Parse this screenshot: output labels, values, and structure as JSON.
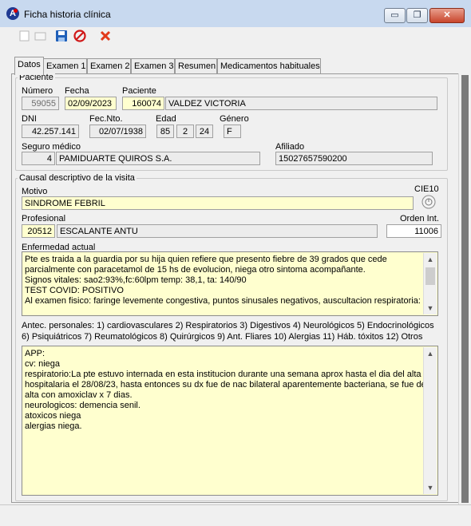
{
  "window": {
    "title": "Ficha historia clínica",
    "buttons": {
      "minimize": "▭",
      "maximize": "❐",
      "close": "✕"
    }
  },
  "toolbar": {
    "icons": [
      "new-doc-icon",
      "open-doc-icon",
      "save-icon",
      "cancel-icon",
      "delete-icon"
    ]
  },
  "tabs": [
    "Datos",
    "Examen 1",
    "Examen 2",
    "Examen 3",
    "Resumen",
    "Medicamentos habituales"
  ],
  "paciente": {
    "legend": "Paciente",
    "numero_label": "Número",
    "numero": "59055",
    "fecha_label": "Fecha",
    "fecha": "02/09/2023",
    "paciente_label": "Paciente",
    "paciente_id": "160074",
    "paciente_nombre": "VALDEZ VICTORIA",
    "dni_label": "DNI",
    "dni": "42.257.141",
    "fecnto_label": "Fec.Nto.",
    "fecnto": "02/07/1938",
    "edad_label": "Edad",
    "edad_anios": "85",
    "edad_meses": "2",
    "edad_dias": "24",
    "genero_label": "Género",
    "genero": "F",
    "seguro_label": "Seguro médico",
    "seguro_id": "4",
    "seguro_nombre": "PAMIDUARTE QUIROS S.A.",
    "afiliado_label": "Afiliado",
    "afiliado": "15027657590200"
  },
  "visita": {
    "legend": "Causal descriptivo de la visita",
    "motivo_label": "Motivo",
    "motivo": "SINDROME FEBRIL",
    "cie_label": "CIE10",
    "profesional_label": "Profesional",
    "profesional_id": "20512",
    "profesional_nombre": "ESCALANTE ANTU",
    "orden_label": "Orden Int.",
    "orden": "11006",
    "enfermedad_label": "Enfermedad actual",
    "enfermedad_lines": [
      "Pte es traida a la guardia por su hija quien refiere que presento fiebre de 39 grados que cede",
      "parcialmente con paracetamol de 15 hs de evolucion, niega otro sintoma acompañante.",
      "Signos vitales: sao2:93%,fc:60lpm temp: 38,1, ta: 140/90",
      "TEST COVID: POSITIVO",
      "Al examen fisico: faringe levemente congestiva, puntos sinusales negativos, auscultacion respiratoria:"
    ],
    "antec_line1": "Antec. personales: 1) cardiovasculares 2) Respiratorios 3) Digestivos 4) Neurológicos  5) Endocrinológicos",
    "antec_line2": "6) Psiquiátricos 7) Reumatológicos 8) Quirúrgicos 9) Ant. Fliares 10) Alergias 11) Háb. tóxitos 12) Otros",
    "antec_lines": [
      "APP:",
      "cv: niega",
      "respiratorio:La pte estuvo internada en esta institucion durante una semana aprox hasta el dia del alta",
      "hospitalaria el 28/08/23, hasta entonces su dx fue de nac bilateral aparentemente bacteriana, se fue de",
      "alta con amoxiclav x 7 dias.",
      "neurologicos: demencia senil.",
      "atoxicos niega",
      "alergias niega."
    ]
  }
}
